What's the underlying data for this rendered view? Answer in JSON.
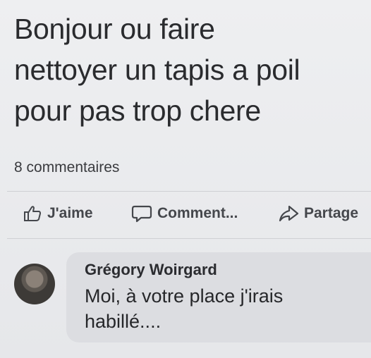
{
  "post": {
    "text_lines": [
      "Bonjour ou faire",
      "nettoyer un tapis a poil",
      "pour pas trop chere"
    ],
    "comment_count": "8 commentaires"
  },
  "actions": {
    "like_label": "J'aime",
    "like_icon": "thumbs-up-icon",
    "comment_label": "Comment...",
    "comment_icon": "speech-bubble-icon",
    "share_label": "Partage",
    "share_icon": "share-arrow-icon"
  },
  "comment": {
    "author": "Grégory Woirgard",
    "text_lines": [
      "Moi, à votre place j'irais",
      "habillé...."
    ]
  }
}
